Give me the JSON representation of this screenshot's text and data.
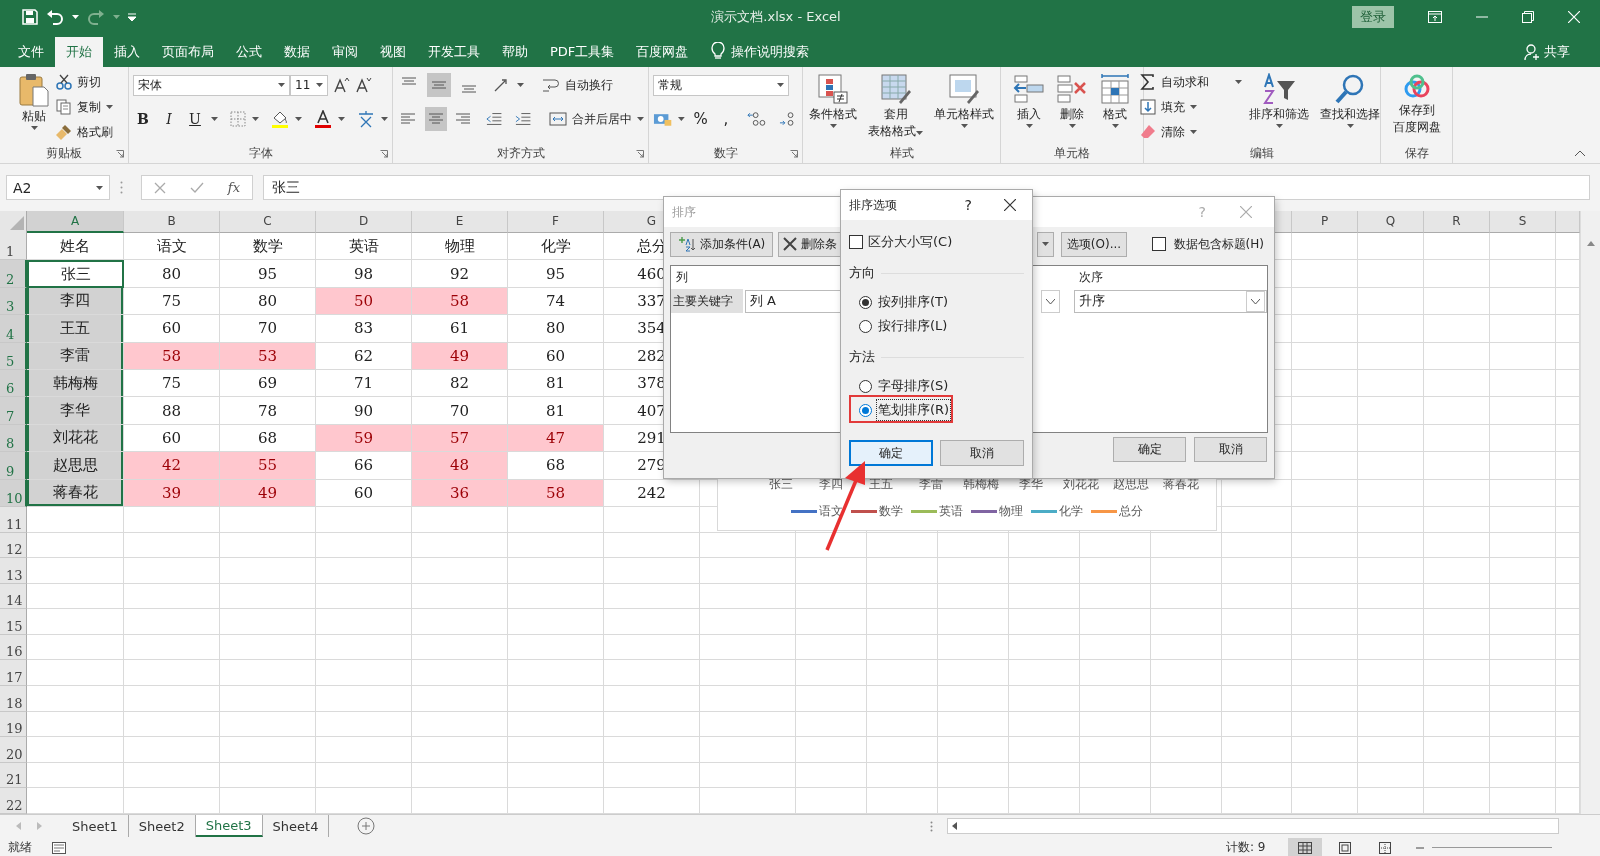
{
  "title_bar": {
    "title": "演示文档.xlsx  -  Excel",
    "sign_in": "登录"
  },
  "tabs": [
    {
      "label": "文件",
      "selected": false
    },
    {
      "label": "开始",
      "selected": true
    },
    {
      "label": "插入",
      "selected": false
    },
    {
      "label": "页面布局",
      "selected": false
    },
    {
      "label": "公式",
      "selected": false
    },
    {
      "label": "数据",
      "selected": false
    },
    {
      "label": "审阅",
      "selected": false
    },
    {
      "label": "视图",
      "selected": false
    },
    {
      "label": "开发工具",
      "selected": false
    },
    {
      "label": "帮助",
      "selected": false
    },
    {
      "label": "PDF工具集",
      "selected": false
    },
    {
      "label": "百度网盘",
      "selected": false
    }
  ],
  "tell_me": "操作说明搜索",
  "share": "共享",
  "ribbon": {
    "groups": [
      {
        "kind": "clipboard",
        "label": "剪贴板",
        "paste": "粘贴",
        "items": [
          "剪切",
          "复制",
          "格式刷"
        ]
      },
      {
        "kind": "font",
        "label": "字体",
        "font_name": "宋体",
        "font_size": "11",
        "styles": [
          "B",
          "I",
          "U"
        ]
      },
      {
        "kind": "alignment",
        "label": "对齐方式",
        "align_buttons": [
          {
            "selected": false
          },
          {
            "selected": true
          },
          {
            "selected": false
          },
          {
            "selected": false
          },
          {
            "selected": true
          },
          {
            "selected": false
          }
        ],
        "wrap": "自动换行",
        "merge": "合并后居中"
      },
      {
        "kind": "number",
        "label": "数字",
        "format": "常规",
        "symbols": [
          "%",
          ","
        ]
      },
      {
        "kind": "styles",
        "label": "样式",
        "buttons": [
          {
            "lines": [
              "条件格式"
            ]
          },
          {
            "lines": [
              "套用",
              "表格格式"
            ]
          },
          {
            "lines": [
              "单元格样式"
            ]
          }
        ]
      },
      {
        "kind": "cells",
        "label": "单元格",
        "buttons": [
          {
            "lines": [
              "插入"
            ]
          },
          {
            "lines": [
              "删除"
            ]
          },
          {
            "lines": [
              "格式"
            ]
          }
        ]
      },
      {
        "kind": "editing",
        "label": "编辑",
        "items": [
          "自动求和",
          "填充",
          "清除"
        ],
        "buttons": [
          {
            "lines": [
              "排序和筛选"
            ]
          },
          {
            "lines": [
              "查找和选择"
            ]
          }
        ]
      },
      {
        "kind": "save",
        "label": "保存",
        "buttons": [
          {
            "lines": [
              "保存到",
              "百度网盘"
            ]
          }
        ]
      }
    ]
  },
  "formula_bar": {
    "name_box": "A2",
    "fx": "fx",
    "value": "张三"
  },
  "sheet": {
    "columns_left": [
      {
        "label": "A",
        "selected": true
      },
      {
        "label": "B",
        "selected": false
      },
      {
        "label": "C",
        "selected": false
      },
      {
        "label": "D",
        "selected": false
      },
      {
        "label": "E",
        "selected": false
      },
      {
        "label": "F",
        "selected": false
      },
      {
        "label": "G",
        "selected": false
      }
    ],
    "columns_right": [
      {
        "label": "P",
        "selected": false
      },
      {
        "label": "Q",
        "selected": false
      },
      {
        "label": "R",
        "selected": false
      },
      {
        "label": "S",
        "selected": false
      }
    ],
    "rows": [
      {
        "number": "1",
        "selected": false,
        "active": false,
        "cells": [
          {
            "text": "姓名",
            "highlight": false
          },
          {
            "text": "语文",
            "highlight": false
          },
          {
            "text": "数学",
            "highlight": false
          },
          {
            "text": "英语",
            "highlight": false
          },
          {
            "text": "物理",
            "highlight": false
          },
          {
            "text": "化学",
            "highlight": false
          },
          {
            "text": "总分",
            "highlight": false
          }
        ]
      },
      {
        "number": "2",
        "selected": true,
        "active": true,
        "cells": [
          {
            "text": "张三",
            "highlight": false
          },
          {
            "text": "80",
            "highlight": false
          },
          {
            "text": "95",
            "highlight": false
          },
          {
            "text": "98",
            "highlight": false
          },
          {
            "text": "92",
            "highlight": false
          },
          {
            "text": "95",
            "highlight": false
          },
          {
            "text": "460",
            "highlight": false
          }
        ]
      },
      {
        "number": "3",
        "selected": true,
        "active": false,
        "cells": [
          {
            "text": "李四",
            "highlight": false
          },
          {
            "text": "75",
            "highlight": false
          },
          {
            "text": "80",
            "highlight": false
          },
          {
            "text": "50",
            "highlight": true
          },
          {
            "text": "58",
            "highlight": true
          },
          {
            "text": "74",
            "highlight": false
          },
          {
            "text": "337",
            "highlight": false
          }
        ]
      },
      {
        "number": "4",
        "selected": true,
        "active": false,
        "cells": [
          {
            "text": "王五",
            "highlight": false
          },
          {
            "text": "60",
            "highlight": false
          },
          {
            "text": "70",
            "highlight": false
          },
          {
            "text": "83",
            "highlight": false
          },
          {
            "text": "61",
            "highlight": false
          },
          {
            "text": "80",
            "highlight": false
          },
          {
            "text": "354",
            "highlight": false
          }
        ]
      },
      {
        "number": "5",
        "selected": true,
        "active": false,
        "cells": [
          {
            "text": "李雷",
            "highlight": false
          },
          {
            "text": "58",
            "highlight": true
          },
          {
            "text": "53",
            "highlight": true
          },
          {
            "text": "62",
            "highlight": false
          },
          {
            "text": "49",
            "highlight": true
          },
          {
            "text": "60",
            "highlight": false
          },
          {
            "text": "282",
            "highlight": false
          }
        ]
      },
      {
        "number": "6",
        "selected": true,
        "active": false,
        "cells": [
          {
            "text": "韩梅梅",
            "highlight": false
          },
          {
            "text": "75",
            "highlight": false
          },
          {
            "text": "69",
            "highlight": false
          },
          {
            "text": "71",
            "highlight": false
          },
          {
            "text": "82",
            "highlight": false
          },
          {
            "text": "81",
            "highlight": false
          },
          {
            "text": "378",
            "highlight": false
          }
        ]
      },
      {
        "number": "7",
        "selected": true,
        "active": false,
        "cells": [
          {
            "text": "李华",
            "highlight": false
          },
          {
            "text": "88",
            "highlight": false
          },
          {
            "text": "78",
            "highlight": false
          },
          {
            "text": "90",
            "highlight": false
          },
          {
            "text": "70",
            "highlight": false
          },
          {
            "text": "81",
            "highlight": false
          },
          {
            "text": "407",
            "highlight": false
          }
        ]
      },
      {
        "number": "8",
        "selected": true,
        "active": false,
        "cells": [
          {
            "text": "刘花花",
            "highlight": false
          },
          {
            "text": "60",
            "highlight": false
          },
          {
            "text": "68",
            "highlight": false
          },
          {
            "text": "59",
            "highlight": true
          },
          {
            "text": "57",
            "highlight": true
          },
          {
            "text": "47",
            "highlight": true
          },
          {
            "text": "291",
            "highlight": false
          }
        ]
      },
      {
        "number": "9",
        "selected": true,
        "active": false,
        "cells": [
          {
            "text": "赵思思",
            "highlight": false
          },
          {
            "text": "42",
            "highlight": true
          },
          {
            "text": "55",
            "highlight": true
          },
          {
            "text": "66",
            "highlight": false
          },
          {
            "text": "48",
            "highlight": true
          },
          {
            "text": "68",
            "highlight": false
          },
          {
            "text": "279",
            "highlight": false
          }
        ]
      },
      {
        "number": "10",
        "selected": true,
        "active": false,
        "cells": [
          {
            "text": "蒋春花",
            "highlight": false
          },
          {
            "text": "39",
            "highlight": true
          },
          {
            "text": "49",
            "highlight": true
          },
          {
            "text": "60",
            "highlight": false
          },
          {
            "text": "36",
            "highlight": true
          },
          {
            "text": "58",
            "highlight": true
          },
          {
            "text": "242",
            "highlight": false
          }
        ]
      },
      {
        "number": "11",
        "selected": false,
        "active": false
      },
      {
        "number": "12",
        "selected": false,
        "active": false
      },
      {
        "number": "13",
        "selected": false,
        "active": false
      },
      {
        "number": "14",
        "selected": false,
        "active": false
      },
      {
        "number": "15",
        "selected": false,
        "active": false
      },
      {
        "number": "16",
        "selected": false,
        "active": false
      },
      {
        "number": "17",
        "selected": false,
        "active": false
      },
      {
        "number": "18",
        "selected": false,
        "active": false
      },
      {
        "number": "19",
        "selected": false,
        "active": false
      },
      {
        "number": "20",
        "selected": false,
        "active": false
      },
      {
        "number": "21",
        "selected": false,
        "active": false
      },
      {
        "number": "22",
        "selected": false,
        "active": false
      }
    ]
  },
  "chart": {
    "categories": [
      "张三",
      "李四",
      "王五",
      "李雷",
      "韩梅梅",
      "李华",
      "刘花花",
      "赵思思",
      "蒋春花"
    ],
    "legend": [
      {
        "label": "语文",
        "color": "#4472c4"
      },
      {
        "label": "数学",
        "color": "#c0504d"
      },
      {
        "label": "英语",
        "color": "#9bbb59"
      },
      {
        "label": "物理",
        "color": "#8064a2"
      },
      {
        "label": "化学",
        "color": "#4bacc6"
      },
      {
        "label": "总分",
        "color": "#f79646"
      }
    ]
  },
  "sort_dialog": {
    "title": "排序",
    "help": "?",
    "add_level": "添加条件(A)",
    "delete_level": "删除条",
    "options": "选项(O)...",
    "has_headers": {
      "label": "数据包含标题(H)",
      "checked": false
    },
    "column_header": "列",
    "order_header": "次序",
    "row_label": "主要关键字",
    "sort_by": "列 A",
    "order": "升序",
    "buttons": [
      "确定",
      "取消"
    ]
  },
  "options_dialog": {
    "title": "排序选项",
    "help": "?",
    "case_sensitive": {
      "label": "区分大小写(C)",
      "checked": false
    },
    "orientation_label": "方向",
    "orientation": [
      {
        "label": "按列排序(T)",
        "selected": true,
        "focused": false
      },
      {
        "label": "按行排序(L)",
        "selected": false,
        "focused": false
      }
    ],
    "method_label": "方法",
    "method": [
      {
        "label": "字母排序(S)",
        "selected": false,
        "focused": false
      },
      {
        "label": "笔划排序(R)",
        "selected": true,
        "focused": true
      }
    ],
    "buttons": [
      {
        "label": "确定",
        "default": true
      },
      {
        "label": "取消",
        "default": false
      }
    ]
  },
  "sheet_tabs": [
    {
      "label": "Sheet1",
      "selected": false
    },
    {
      "label": "Sheet2",
      "selected": false
    },
    {
      "label": "Sheet3",
      "selected": true
    },
    {
      "label": "Sheet4",
      "selected": false
    }
  ],
  "status_bar": {
    "ready": "就绪",
    "count": "计数: 9"
  }
}
